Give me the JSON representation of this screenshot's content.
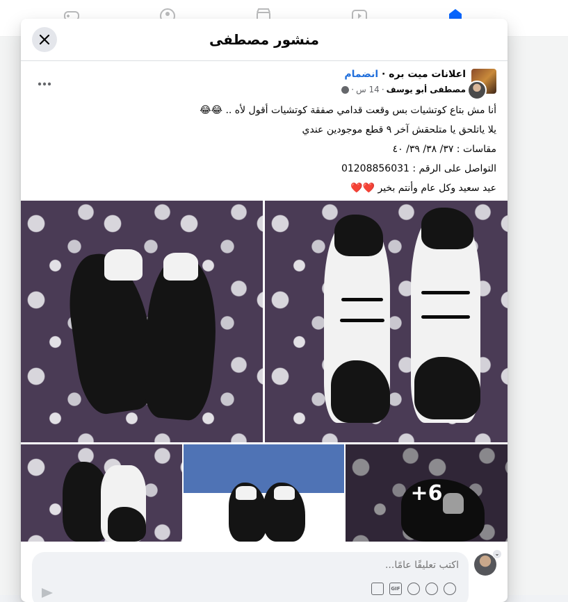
{
  "dialog": {
    "title": "منشور مصطفى",
    "close_icon": "close-icon"
  },
  "post": {
    "group_name": "اعلانات ميت بره",
    "separator": "·",
    "join_label": "انضمام",
    "author": "مصطفى أبو يوسف",
    "time": "14 س",
    "privacy_icon": "globe-icon",
    "more_icon": "more-options-icon",
    "lines": [
      "أنا مش بتاع كوتشيات بس وقعت قدامي صفقة كوتشيات أقول لأه ..",
      "يلا ياتلحق يا متلحقش آخر ٩ قطع موجودين عندي",
      "مقاسات : ٣٧/ ٣٨/ ٣٩/ ٤٠",
      "التواصل على الرقم : 01208856031",
      "عيد سعيد وكل عام وأنتم بخير"
    ],
    "line1_emoji": "😂😂",
    "line5_emoji": "❤️❤️"
  },
  "photos": {
    "more_count": "+6"
  },
  "comment": {
    "placeholder": "اكتب تعليقًا عامًا...",
    "icons": [
      "avatar-sticker-icon",
      "emoji-icon",
      "camera-icon",
      "gif-icon",
      "sticker-icon"
    ],
    "gif_label": "GIF",
    "send_icon": "send-icon"
  },
  "colors": {
    "link": "#216fdb",
    "secondary_text": "#65676b",
    "accent": "#0866ff"
  }
}
